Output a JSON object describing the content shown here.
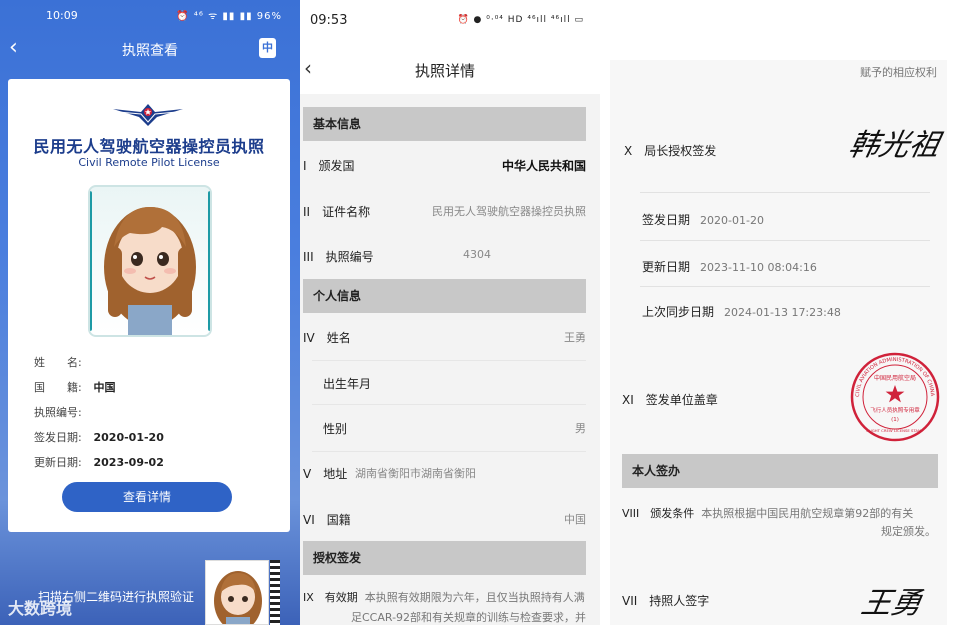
{
  "panel1": {
    "status": {
      "time": "10:09",
      "icons": "⏰ ⁴⁶ ᯤ ▮▮ ▮▮ 96%"
    },
    "nav": {
      "back": "‹",
      "title": "执照查看",
      "lang_badge": "中"
    },
    "card": {
      "title_cn": "民用无人驾驶航空器操控员执照",
      "title_en": "Civil Remote Pilot License",
      "fields": [
        {
          "label": "姓　　名:",
          "value": ""
        },
        {
          "label": "国　　籍:",
          "value": "中国"
        },
        {
          "label": "执照编号:",
          "value": ""
        },
        {
          "label": "签发日期:",
          "value": "2020-01-20"
        },
        {
          "label": "更新日期:",
          "value": "2023-09-02"
        }
      ],
      "view_button": "查看详情"
    },
    "scan_text": "扫描右侧二维码进行执照验证",
    "watermark": "大数跨境"
  },
  "panel2": {
    "status": {
      "time": "09:53",
      "icons": "⏰ ● ⁰·⁰⁴ HD ⁴⁶ıll ⁴⁶ıll ▭"
    },
    "nav": {
      "back": "‹",
      "title": "执照详情"
    },
    "sections": {
      "basic": "基本信息",
      "personal": "个人信息",
      "auth": "授权签发"
    },
    "rows": {
      "issuing_country": {
        "label": "I　颁发国",
        "value": "中华人民共和国"
      },
      "cert_name": {
        "label": "II　证件名称",
        "value": "民用无人驾驶航空器操控员执照"
      },
      "license_no": {
        "label": "III　执照编号",
        "value": "4304"
      },
      "name": {
        "label": "IV　姓名",
        "value": "王勇"
      },
      "birth": {
        "label": "出生年月",
        "value": ""
      },
      "gender": {
        "label": "性别",
        "value": "男"
      },
      "address": {
        "label": "V　地址",
        "value": "湖南省衡阳市湖南省衡阳"
      },
      "nationality": {
        "label": "VI　国籍",
        "value": "中国"
      }
    },
    "validity": {
      "label": "IX　有效期",
      "text1": "本执照有效期限为六年，且仅当执照持有人满",
      "text2": "足CCAR-92部和有关规章的训练与检查要求，并"
    }
  },
  "panel3": {
    "rights_tail": "赋予的相应权利",
    "director_sign": {
      "label": "X　局长授权签发",
      "signature": "韩光祖"
    },
    "dates": [
      {
        "label": "签发日期",
        "value": "2020-01-20"
      },
      {
        "label": "更新日期",
        "value": "2023-11-10 08:04:16"
      },
      {
        "label": "上次同步日期",
        "value": "2024-01-13 17:23:48"
      }
    ],
    "seal_row": {
      "label": "XI　签发单位盖章"
    },
    "seal": {
      "ring_text": "CIVIL AVIATION ADMINISTRATION OF CHINA",
      "top_text": "中国民用航空局",
      "middle_text": "飞行人员执照专用章",
      "number": "(1)",
      "bottom_text": "FLIGHT CREW LICENSE STAMP"
    },
    "self_sign_section": "本人签办",
    "condition": {
      "label": "VIII　颁发条件",
      "text1": "本执照根据中国民用航空规章第92部的有关",
      "text2": "规定颁发。"
    },
    "holder_sign": {
      "label": "VII　持照人签字",
      "signature": "王勇"
    }
  },
  "colors": {
    "brand_blue": "#3b71d6",
    "button_blue": "#2f63c6",
    "title_navy": "#1c3d8c",
    "seal_red": "#d0223a"
  }
}
